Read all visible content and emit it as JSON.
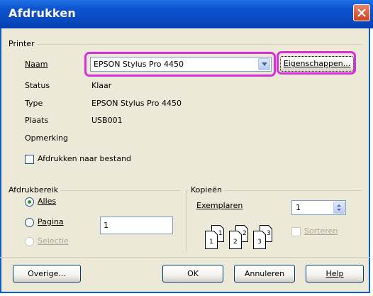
{
  "window": {
    "title": "Afdrukken"
  },
  "printer": {
    "group_label": "Printer",
    "name_label": "Naam",
    "name_value": "EPSON Stylus Pro 4450",
    "properties_button": "Eigenschappen...",
    "status_label": "Status",
    "status_value": "Klaar",
    "type_label": "Type",
    "type_value": "EPSON Stylus Pro 4450",
    "location_label": "Plaats",
    "location_value": "USB001",
    "comment_label": "Opmerking",
    "print_to_file_label": "Afdrukken naar bestand"
  },
  "print_range": {
    "group_label": "Afdrukbereik",
    "all_label": "Alles",
    "pages_label": "Pagina",
    "pages_value": "1",
    "selection_label": "Selectie"
  },
  "copies": {
    "group_label": "Kopieën",
    "copies_label": "Exemplaren",
    "copies_value": "1",
    "collate_label": "Sorteren",
    "page_numbers": [
      "1",
      "1",
      "2",
      "2",
      "3",
      "3"
    ]
  },
  "buttons": {
    "other": "Overige...",
    "ok": "OK",
    "cancel": "Annuleren",
    "help": "Help"
  },
  "colors": {
    "titlebar": "#0a49c0",
    "dialog_bg": "#ece9d8",
    "highlight": "#d830d6"
  },
  "icons": [
    "close-icon",
    "chevron-down-icon",
    "spin-arrows-icon",
    "copies-collate-icon"
  ]
}
